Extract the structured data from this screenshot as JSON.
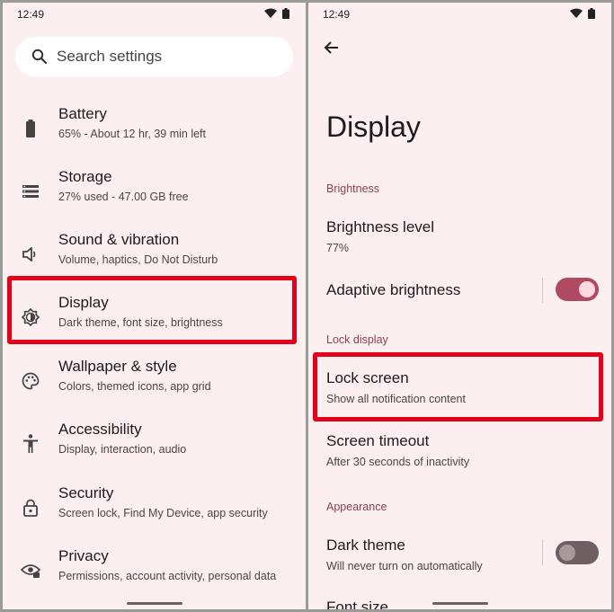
{
  "left": {
    "status": {
      "time": "12:49"
    },
    "search": {
      "placeholder": "Search settings"
    },
    "items": [
      {
        "title": "Battery",
        "sub": "65% - About 12 hr, 39 min left",
        "icon": "battery-icon"
      },
      {
        "title": "Storage",
        "sub": "27% used - 47.00 GB free",
        "icon": "storage-icon"
      },
      {
        "title": "Sound & vibration",
        "sub": "Volume, haptics, Do Not Disturb",
        "icon": "volume-icon"
      },
      {
        "title": "Display",
        "sub": "Dark theme, font size, brightness",
        "icon": "brightness-icon"
      },
      {
        "title": "Wallpaper & style",
        "sub": "Colors, themed icons, app grid",
        "icon": "palette-icon"
      },
      {
        "title": "Accessibility",
        "sub": "Display, interaction, audio",
        "icon": "accessibility-icon"
      },
      {
        "title": "Security",
        "sub": "Screen lock, Find My Device, app security",
        "icon": "lock-icon"
      },
      {
        "title": "Privacy",
        "sub": "Permissions, account activity, personal data",
        "icon": "privacy-eye-icon"
      }
    ]
  },
  "right": {
    "status": {
      "time": "12:49"
    },
    "title": "Display",
    "sections": {
      "brightness": "Brightness",
      "lock_display": "Lock display",
      "appearance": "Appearance"
    },
    "brightness_level": {
      "title": "Brightness level",
      "sub": "77%"
    },
    "adaptive_brightness": {
      "title": "Adaptive brightness",
      "on": true
    },
    "lock_screen": {
      "title": "Lock screen",
      "sub": "Show all notification content"
    },
    "screen_timeout": {
      "title": "Screen timeout",
      "sub": "After 30 seconds of inactivity"
    },
    "dark_theme": {
      "title": "Dark theme",
      "sub": "Will never turn on automatically",
      "on": false
    },
    "font_size": {
      "title": "Font size"
    }
  },
  "colors": {
    "background": "#fcefef",
    "highlight": "#e3001b",
    "section_label": "#8f3e55",
    "toggle_on": "#b04a62"
  }
}
